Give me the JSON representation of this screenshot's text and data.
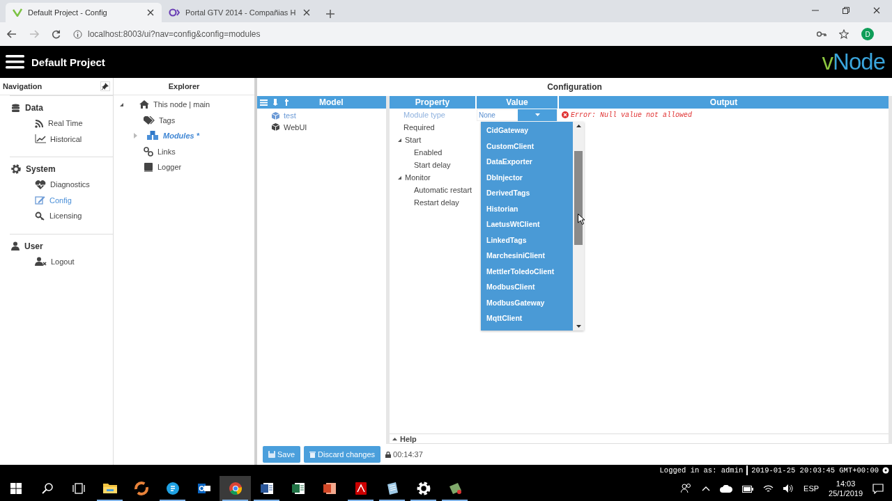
{
  "browser": {
    "tabs": [
      {
        "title": "Default Project - Config",
        "selected": true
      },
      {
        "title": "Portal GTV 2014 - Compañias H",
        "selected": false
      }
    ],
    "url": "localhost:8003/ui?nav=config&config=modules",
    "profile_initial": "D"
  },
  "header": {
    "project": "Default Project",
    "logo": "vNode"
  },
  "navigation": {
    "title": "Navigation",
    "groups": [
      {
        "label": "Data",
        "items": [
          {
            "label": "Real Time",
            "selected": false
          },
          {
            "label": "Historical",
            "selected": false
          }
        ]
      },
      {
        "label": "System",
        "items": [
          {
            "label": "Diagnostics",
            "selected": false
          },
          {
            "label": "Config",
            "selected": true
          },
          {
            "label": "Licensing",
            "selected": false
          }
        ]
      },
      {
        "label": "User",
        "items": [
          {
            "label": "Logout",
            "selected": false
          }
        ]
      }
    ]
  },
  "explorer": {
    "title": "Explorer",
    "root": {
      "label": "This node | main",
      "expanded": true,
      "selected": false,
      "children": [
        {
          "label": "Tags",
          "selected": false
        },
        {
          "label": "Modules *",
          "selected": true,
          "expanded": false
        },
        {
          "label": "Links",
          "selected": false
        },
        {
          "label": "Logger",
          "selected": false
        }
      ]
    }
  },
  "config": {
    "title": "Configuration",
    "model": {
      "title": "Model",
      "items": [
        {
          "label": "test",
          "selected": true
        },
        {
          "label": "WebUI",
          "selected": false
        }
      ]
    },
    "grid": {
      "columns": [
        "Property",
        "Value",
        "Output"
      ],
      "rows": [
        {
          "name": "Module type",
          "value": "None",
          "selected": true,
          "error": "Error: Null value not allowed"
        },
        {
          "name": "Required",
          "selected": false
        },
        {
          "name": "Start",
          "selected": false,
          "expanded": true,
          "children": [
            {
              "name": "Enabled",
              "selected": false
            },
            {
              "name": "Start delay",
              "selected": false
            }
          ]
        },
        {
          "name": "Monitor",
          "selected": false,
          "expanded": true,
          "children": [
            {
              "name": "Automatic restart",
              "selected": false
            },
            {
              "name": "Restart delay",
              "selected": false
            }
          ]
        }
      ]
    },
    "dropdown": {
      "options": [
        "CidGateway",
        "CustomClient",
        "DataExporter",
        "DbInjector",
        "DerivedTags",
        "Historian",
        "LaetusWtClient",
        "LinkedTags",
        "MarchesiniClient",
        "MettlerToledoClient",
        "ModbusClient",
        "ModbusGateway",
        "MqttClient"
      ]
    },
    "help": {
      "label": "Help",
      "expanded": false
    },
    "buttons": [
      "Save",
      "Discard changes"
    ],
    "lock_time": "00:14:37"
  },
  "status": {
    "user": "Logged in as: admin",
    "datetime": "2019-01-25 20:03:45 GMT+00:00"
  },
  "taskbar": {
    "apps": [
      {
        "running": true,
        "selected": false
      },
      {
        "running": false,
        "selected": false
      },
      {
        "running": true,
        "selected": false
      },
      {
        "running": false,
        "selected": false
      },
      {
        "running": true,
        "selected": true
      },
      {
        "running": true,
        "selected": false
      },
      {
        "running": false,
        "selected": false
      },
      {
        "running": false,
        "selected": false
      },
      {
        "running": true,
        "selected": false
      },
      {
        "running": true,
        "selected": false
      },
      {
        "running": true,
        "selected": false
      },
      {
        "running": true,
        "selected": false
      }
    ],
    "tray": {
      "language": "ESP",
      "time": "14:03",
      "date": "25/1/2019"
    }
  }
}
